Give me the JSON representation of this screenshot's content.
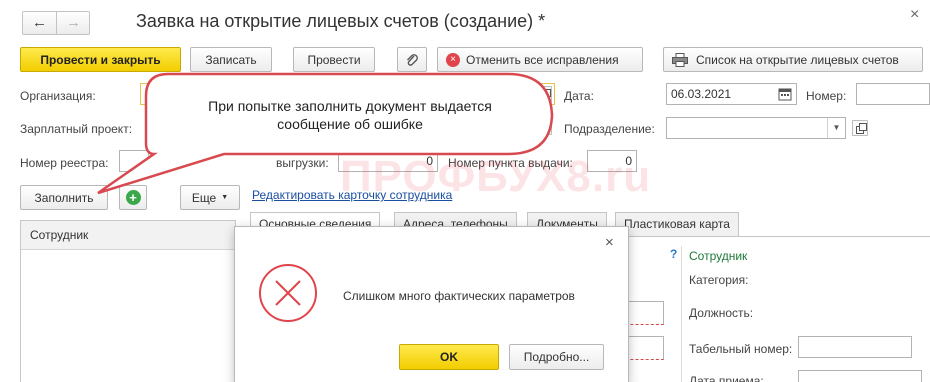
{
  "title": "Заявка на открытие лицевых счетов (создание) *",
  "toolbar": {
    "post_close": "Провести и закрыть",
    "save": "Записать",
    "post": "Провести",
    "cancel_fixes": "Отменить все исправления",
    "list_accounts": "Список на открытие лицевых счетов"
  },
  "form": {
    "org_label": "Организация:",
    "date_label": "Дата:",
    "date_value": "06.03.2021",
    "number_label": "Номер:",
    "salary_label": "Зарплатный проект:",
    "division_label": "Подразделение:",
    "registry_label": "Номер реестра:",
    "upload_label": "выгрузки:",
    "upload_value": "0",
    "point_label": "Номер пункта выдачи:",
    "point_value": "0"
  },
  "actions": {
    "fill": "Заполнить",
    "more": "Еще",
    "edit_link": "Редактировать карточку сотрудника"
  },
  "tabs": [
    "Основные сведения",
    "Адреса, телефоны",
    "Документы",
    "Пластиковая карта"
  ],
  "table": {
    "employee_header": "Сотрудник"
  },
  "right_panel": {
    "help": "?",
    "section": "Сотрудник",
    "category": "Категория:",
    "position": "Должность:",
    "tab_number": "Табельный номер:",
    "hire_date": "Дата приема:"
  },
  "callout": {
    "text": "При попытке заполнить документ выдается сообщение об ошибке"
  },
  "watermark": "ПРОФБУХ8.ru",
  "dialog": {
    "message": "Слишком много фактических параметров",
    "ok": "OK",
    "details": "Подробно..."
  },
  "colors": {
    "accent_yellow": "#f5d200",
    "error_red": "#e0454b",
    "link_blue": "#1a4fa0",
    "section_green": "#1e7a3a",
    "callout_border": "#d84a4f"
  }
}
